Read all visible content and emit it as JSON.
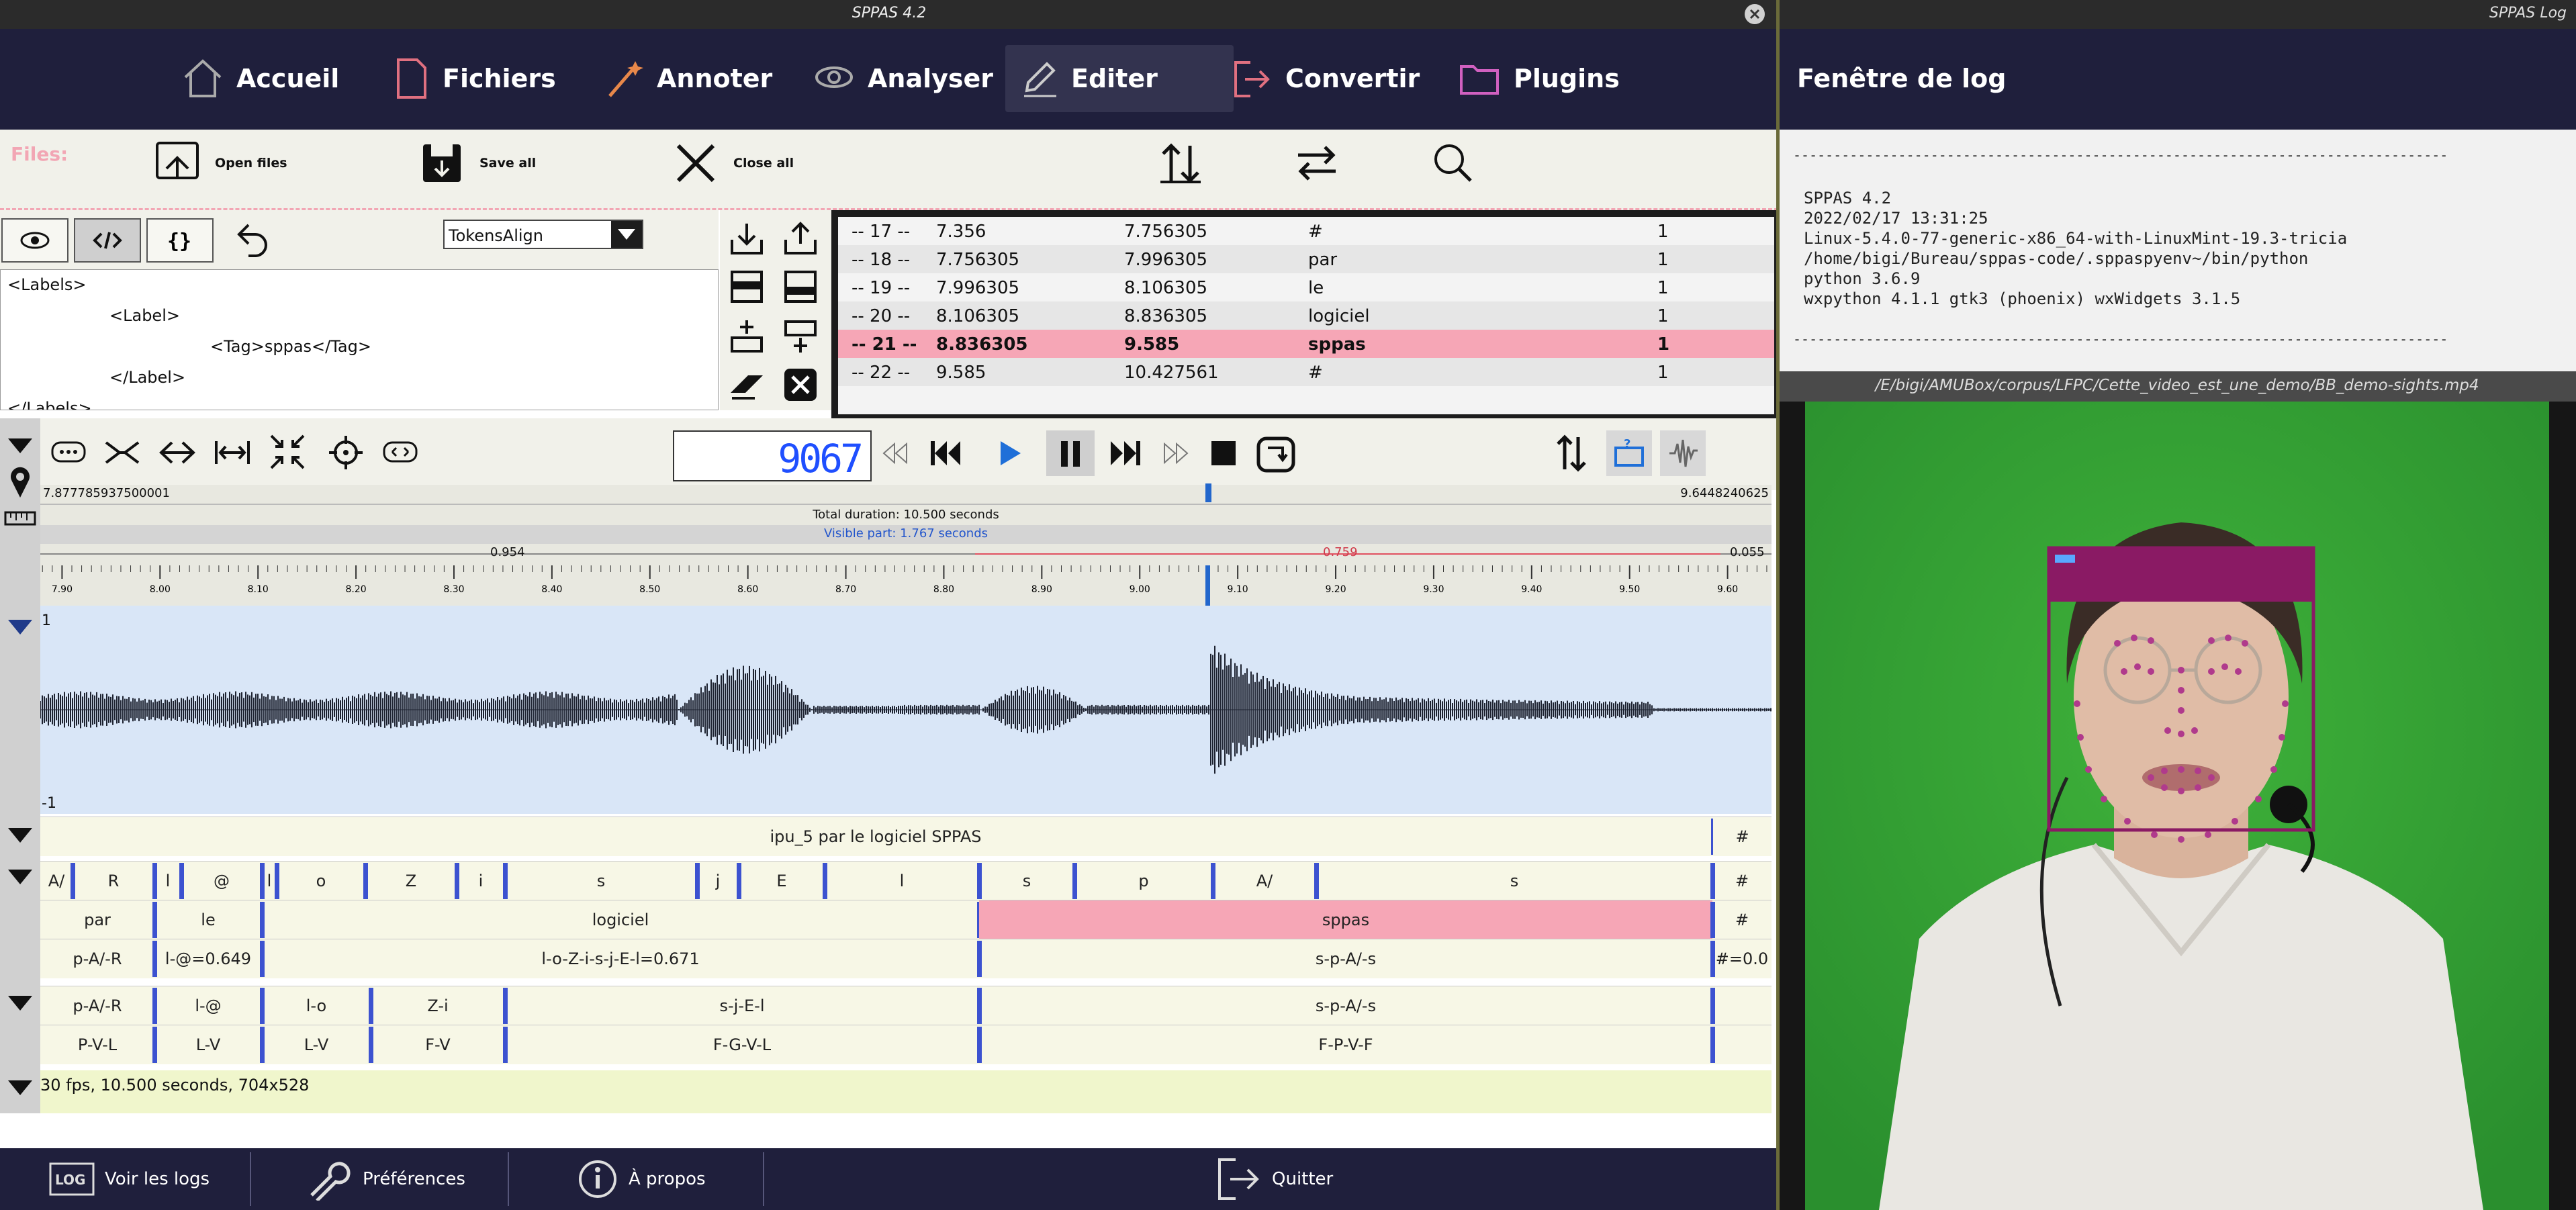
{
  "window": {
    "title": "SPPAS 4.2",
    "log_title": "SPPAS Log"
  },
  "nav": [
    {
      "label": "Accueil",
      "icon": "home-icon"
    },
    {
      "label": "Fichiers",
      "icon": "file-icon"
    },
    {
      "label": "Annoter",
      "icon": "wand-icon"
    },
    {
      "label": "Analyser",
      "icon": "eye-icon"
    },
    {
      "label": "Editer",
      "icon": "pen-icon",
      "active": true
    },
    {
      "label": "Convertir",
      "icon": "export-icon"
    },
    {
      "label": "Plugins",
      "icon": "folder-icon"
    }
  ],
  "files_bar": {
    "label": "Files:",
    "open": "Open files",
    "save_all": "Save all",
    "close_all": "Close all"
  },
  "tier_select": {
    "value": "TokensAlign"
  },
  "xml_lines": [
    "<Labels>",
    "<Label>",
    "<Tag>sppas</Tag>",
    "</Label>",
    "</Labels>"
  ],
  "annotations": [
    {
      "idx": "-- 17 --",
      "begin": "7.356",
      "end": "7.756305",
      "label": "#",
      "n": "1"
    },
    {
      "idx": "-- 18 --",
      "begin": "7.756305",
      "end": "7.996305",
      "label": "par",
      "n": "1"
    },
    {
      "idx": "-- 19 --",
      "begin": "7.996305",
      "end": "8.106305",
      "label": "le",
      "n": "1"
    },
    {
      "idx": "-- 20 --",
      "begin": "8.106305",
      "end": "8.836305",
      "label": "logiciel",
      "n": "1"
    },
    {
      "idx": "-- 21 --",
      "begin": "8.836305",
      "end": "9.585",
      "label": "sppas",
      "n": "1",
      "selected": true
    },
    {
      "idx": "-- 22 --",
      "begin": "9.585",
      "end": "10.427561",
      "label": "#",
      "n": "1"
    }
  ],
  "player": {
    "timer": "9067"
  },
  "timeline": {
    "start": "7.877785937500001",
    "end": "9.6448240625",
    "total": "Total duration:  10.500 seconds",
    "visible": "Visible part:  1.767 seconds",
    "sel_before": "0.954",
    "sel_dur": "0.759",
    "sel_after": "0.055",
    "ticks": [
      "7.90",
      "8.00",
      "8.10",
      "8.20",
      "8.30",
      "8.40",
      "8.50",
      "8.60",
      "8.70",
      "8.80",
      "8.90",
      "9.00",
      "9.10",
      "9.20",
      "9.30",
      "9.40",
      "9.50",
      "9.60"
    ]
  },
  "waveform": {
    "max": "1",
    "min": "-1"
  },
  "tiers": {
    "ipu": {
      "text": "ipu_5 par le logiciel SPPAS",
      "end": "#"
    },
    "phones": [
      "A/",
      "R",
      "l",
      "@",
      "l",
      "o",
      "Z",
      "i",
      "s",
      "j",
      "E",
      "l",
      "s",
      "p",
      "A/",
      "s",
      "#"
    ],
    "tokens": [
      "par",
      "le",
      "logiciel",
      "sppas",
      "#"
    ],
    "syll_tok": [
      "p-A/-R",
      "l-@=0.649",
      "l-o-Z-i-s-j-E-l=0.671",
      "s-p-A/-s",
      "#=0.0"
    ],
    "syll": [
      "p-A/-R",
      "l-@",
      "l-o",
      "Z-i",
      "s-j-E-l",
      "s-p-A/-s"
    ],
    "classes": [
      "P-V-L",
      "L-V",
      "L-V",
      "F-V",
      "F-G-V-L",
      "F-P-V-F"
    ]
  },
  "video_info": "30 fps, 10.500 seconds, 704x528",
  "bottom": {
    "logs": "Voir les logs",
    "prefs": "Préférences",
    "about": "À propos",
    "quit": "Quitter"
  },
  "log": {
    "heading": "Fenêtre de log",
    "separator": "---------------------------------------------------------------------------------",
    "lines": [
      "SPPAS 4.2",
      "2022/02/17 13:31:25",
      "Linux-5.4.0-77-generic-x86_64-with-LinuxMint-19.3-tricia",
      "/home/bigi/Bureau/sppas-code/.sppaspyenv~/bin/python",
      "python 3.6.9",
      "wxpython 4.1.1 gtk3 (phoenix) wxWidgets 3.1.5"
    ]
  },
  "video": {
    "path": "/E/bigi/AMUBox/corpus/LFPC/Cette_video_est_une_demo/BB_demo-sights.mp4"
  }
}
